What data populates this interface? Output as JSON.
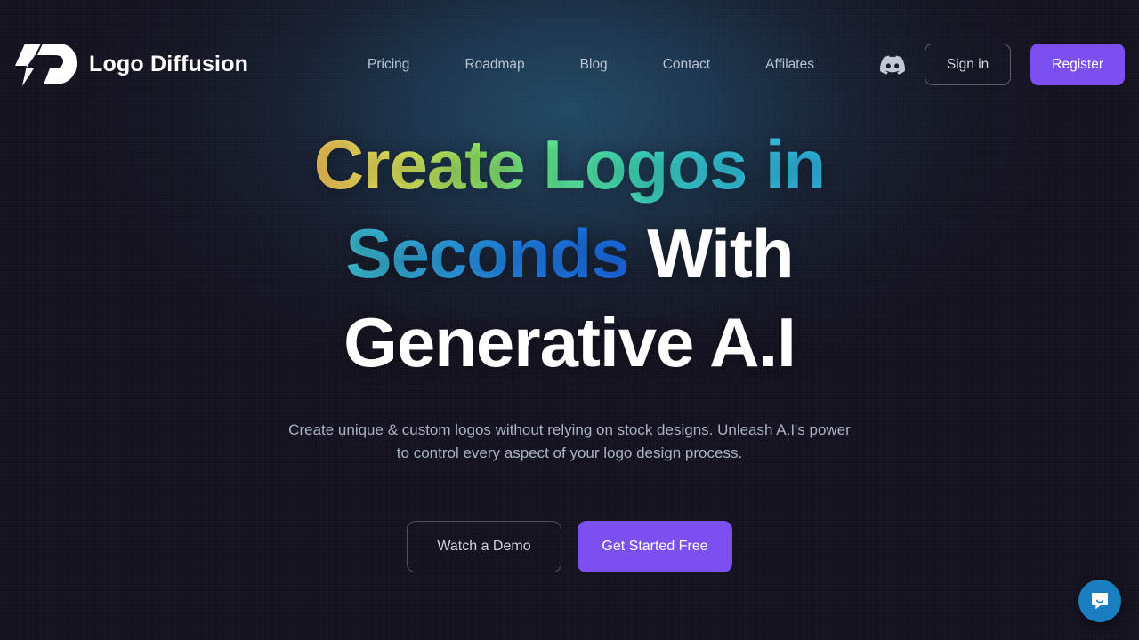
{
  "brand": {
    "name": "Logo Diffusion",
    "logo_icon": "lightning-bolt-d-monogram-icon"
  },
  "nav": {
    "items": [
      {
        "label": "Pricing"
      },
      {
        "label": "Roadmap"
      },
      {
        "label": "Blog"
      },
      {
        "label": "Contact"
      },
      {
        "label": "Affilates"
      }
    ]
  },
  "header_actions": {
    "discord_icon": "discord-icon",
    "sign_in_label": "Sign in",
    "register_label": "Register"
  },
  "hero": {
    "headline_line1_gradient": "Create Logos in",
    "headline_line2_gradient": "Seconds",
    "headline_line2_plain": "With",
    "headline_line3_plain": "Generative A.I",
    "subtitle_line1": "Create unique & custom logos without relying on stock designs. Unleash A.I's power",
    "subtitle_line2": "to control every aspect of your logo design process.",
    "cta_secondary_label": "Watch a Demo",
    "cta_primary_label": "Get Started Free"
  },
  "chat": {
    "launcher_icon": "chat-bubble-smile-icon"
  },
  "colors": {
    "page_background": "#15121f",
    "glow": "#234c68",
    "accent_purple": "#7c4ff0",
    "cta_purple": "#7c50f0",
    "chat_blue": "#1a7ec0",
    "nav_text": "#b9c3d4",
    "subtitle_text": "#a9b2c6",
    "headline_white": "#ffffff",
    "gradient_start": "#fbc85a",
    "gradient_mid_green": "#5ef2a0",
    "gradient_mid_cyan": "#38cfe0",
    "gradient_end_blue": "#1d6ef0"
  }
}
